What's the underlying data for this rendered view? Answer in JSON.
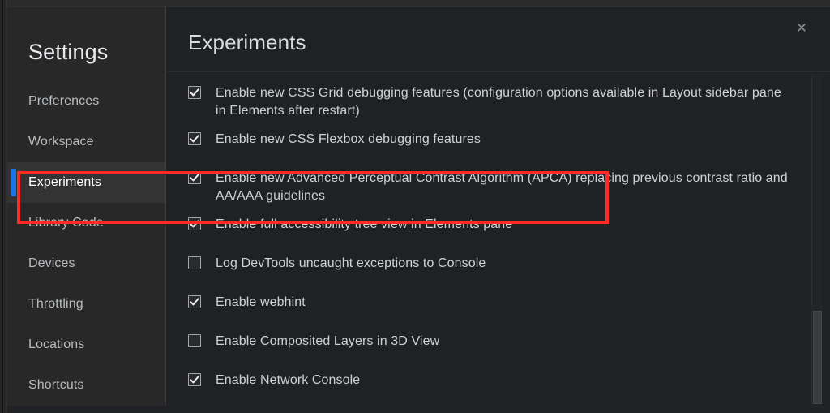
{
  "window": {
    "accent_color": "#1a73e8",
    "highlight_color": "#ff2a21",
    "background_color": "#202124"
  },
  "sidebar": {
    "title": "Settings",
    "items": [
      {
        "label": "Preferences",
        "selected": false
      },
      {
        "label": "Workspace",
        "selected": false
      },
      {
        "label": "Experiments",
        "selected": true
      },
      {
        "label": "Library Code",
        "selected": false
      },
      {
        "label": "Devices",
        "selected": false
      },
      {
        "label": "Throttling",
        "selected": false
      },
      {
        "label": "Locations",
        "selected": false
      },
      {
        "label": "Shortcuts",
        "selected": false
      }
    ]
  },
  "header": {
    "title": "Experiments",
    "close_icon": "close-icon",
    "close_glyph": "✕"
  },
  "experiments": [
    {
      "label": "Enable new CSS Grid debugging features (configuration options available in Layout sidebar pane in Elements after restart)",
      "checked": true,
      "highlighted": false
    },
    {
      "label": "Enable new CSS Flexbox debugging features",
      "checked": true,
      "highlighted": false
    },
    {
      "label": "Enable new Advanced Perceptual Contrast Algorithm (APCA) replacing previous contrast ratio and AA/AAA guidelines",
      "checked": true,
      "highlighted": true
    },
    {
      "label": "Enable full accessibility tree view in Elements pane",
      "checked": true,
      "highlighted": false
    },
    {
      "label": "Log DevTools uncaught exceptions to Console",
      "checked": false,
      "highlighted": false
    },
    {
      "label": "Enable webhint",
      "checked": true,
      "highlighted": false
    },
    {
      "label": "Enable Composited Layers in 3D View",
      "checked": false,
      "highlighted": false
    },
    {
      "label": "Enable Network Console",
      "checked": true,
      "highlighted": false
    }
  ],
  "scrollbar": {
    "name": "vertical-scrollbar",
    "thumb_name": "vertical-scrollbar-thumb"
  }
}
